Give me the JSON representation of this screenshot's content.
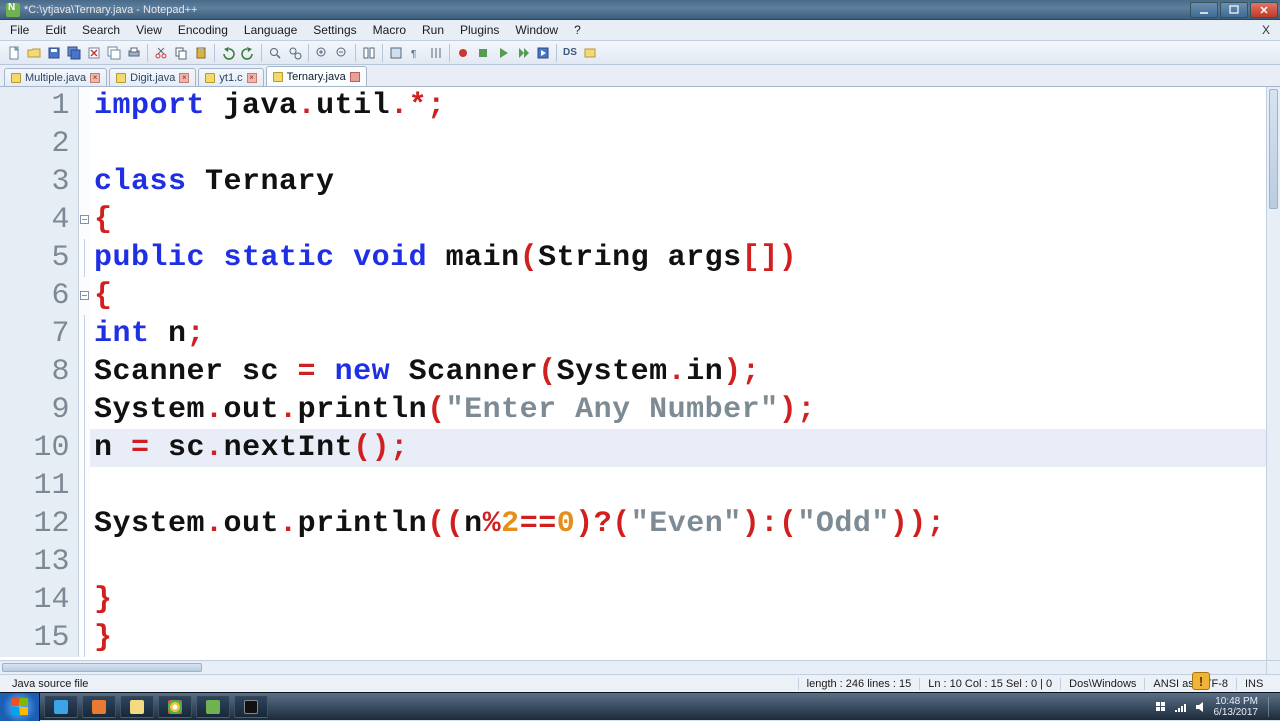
{
  "window": {
    "title": "*C:\\ytjava\\Ternary.java - Notepad++"
  },
  "menu": {
    "items": [
      "File",
      "Edit",
      "Search",
      "View",
      "Encoding",
      "Language",
      "Settings",
      "Macro",
      "Run",
      "Plugins",
      "Window",
      "?"
    ],
    "close_doc": "X"
  },
  "toolbar": {
    "text_btn": "DS"
  },
  "tabs": [
    {
      "label": "Multiple.java",
      "active": false,
      "dirty": false
    },
    {
      "label": "Digit.java",
      "active": false,
      "dirty": false
    },
    {
      "label": "yt1.c",
      "active": false,
      "dirty": false
    },
    {
      "label": "Ternary.java",
      "active": true,
      "dirty": true
    }
  ],
  "code": {
    "highlight_line": 10,
    "lines": [
      {
        "n": 1,
        "fold": null,
        "tokens": [
          [
            "kw",
            "import"
          ],
          [
            "",
            " java"
          ],
          [
            "op",
            "."
          ],
          [
            "",
            "util"
          ],
          [
            "op",
            "."
          ],
          [
            "op",
            "*"
          ],
          [
            "op",
            ";"
          ]
        ]
      },
      {
        "n": 2,
        "fold": null,
        "tokens": []
      },
      {
        "n": 3,
        "fold": null,
        "tokens": [
          [
            "kw",
            "class"
          ],
          [
            "",
            " Ternary"
          ]
        ]
      },
      {
        "n": 4,
        "fold": "box",
        "tokens": [
          [
            "op",
            "{"
          ]
        ]
      },
      {
        "n": 5,
        "fold": "line",
        "tokens": [
          [
            "kw",
            "public"
          ],
          [
            "",
            " "
          ],
          [
            "kw",
            "static"
          ],
          [
            "",
            " "
          ],
          [
            "kw",
            "void"
          ],
          [
            "",
            " main"
          ],
          [
            "op",
            "("
          ],
          [
            "",
            "String args"
          ],
          [
            "op",
            "["
          ],
          [
            "op",
            "]"
          ],
          [
            "op",
            ")"
          ]
        ]
      },
      {
        "n": 6,
        "fold": "box",
        "tokens": [
          [
            "op",
            "{"
          ]
        ]
      },
      {
        "n": 7,
        "fold": "line",
        "tokens": [
          [
            "kw",
            "int"
          ],
          [
            "",
            " n"
          ],
          [
            "op",
            ";"
          ]
        ]
      },
      {
        "n": 8,
        "fold": "line",
        "tokens": [
          [
            "",
            "Scanner sc "
          ],
          [
            "op",
            "="
          ],
          [
            "",
            " "
          ],
          [
            "kw",
            "new"
          ],
          [
            "",
            " Scanner"
          ],
          [
            "op",
            "("
          ],
          [
            "",
            "System"
          ],
          [
            "op",
            "."
          ],
          [
            "",
            "in"
          ],
          [
            "op",
            ")"
          ],
          [
            "op",
            ";"
          ]
        ]
      },
      {
        "n": 9,
        "fold": "line",
        "tokens": [
          [
            "",
            "System"
          ],
          [
            "op",
            "."
          ],
          [
            "",
            "out"
          ],
          [
            "op",
            "."
          ],
          [
            "",
            "println"
          ],
          [
            "op",
            "("
          ],
          [
            "str",
            "\"Enter Any Number\""
          ],
          [
            "op",
            ")"
          ],
          [
            "op",
            ";"
          ]
        ]
      },
      {
        "n": 10,
        "fold": "line",
        "tokens": [
          [
            "",
            "n "
          ],
          [
            "op",
            "="
          ],
          [
            "",
            " sc"
          ],
          [
            "op",
            "."
          ],
          [
            "",
            "nextInt"
          ],
          [
            "paren-hl",
            "("
          ],
          [
            "paren-hl",
            ")"
          ],
          [
            "op",
            ";"
          ]
        ]
      },
      {
        "n": 11,
        "fold": "line",
        "tokens": []
      },
      {
        "n": 12,
        "fold": "line",
        "tokens": [
          [
            "",
            "System"
          ],
          [
            "op",
            "."
          ],
          [
            "",
            "out"
          ],
          [
            "op",
            "."
          ],
          [
            "",
            "println"
          ],
          [
            "op",
            "("
          ],
          [
            "op",
            "("
          ],
          [
            "",
            "n"
          ],
          [
            "op",
            "%"
          ],
          [
            "num",
            "2"
          ],
          [
            "op",
            "=="
          ],
          [
            "num",
            "0"
          ],
          [
            "op",
            ")"
          ],
          [
            "op",
            "?"
          ],
          [
            "op",
            "("
          ],
          [
            "str",
            "\"Even\""
          ],
          [
            "op",
            ")"
          ],
          [
            "op",
            ":"
          ],
          [
            "op",
            "("
          ],
          [
            "str",
            "\"Odd\""
          ],
          [
            "op",
            ")"
          ],
          [
            "op",
            ")"
          ],
          [
            "op",
            ";"
          ]
        ]
      },
      {
        "n": 13,
        "fold": "line",
        "tokens": []
      },
      {
        "n": 14,
        "fold": "line",
        "tokens": [
          [
            "op",
            "}"
          ]
        ]
      },
      {
        "n": 15,
        "fold": "line",
        "tokens": [
          [
            "op",
            "}"
          ]
        ]
      }
    ]
  },
  "status": {
    "left": "Java source file",
    "len_lines": "length : 246    lines : 15",
    "pos": "Ln : 10    Col : 15    Sel : 0 | 0",
    "eol": "Dos\\Windows",
    "enc": "ANSI as UTF-8",
    "ovr": "INS"
  },
  "taskbar": {
    "time": "10:48 PM",
    "date": "6/13/2017",
    "notif": "!"
  }
}
